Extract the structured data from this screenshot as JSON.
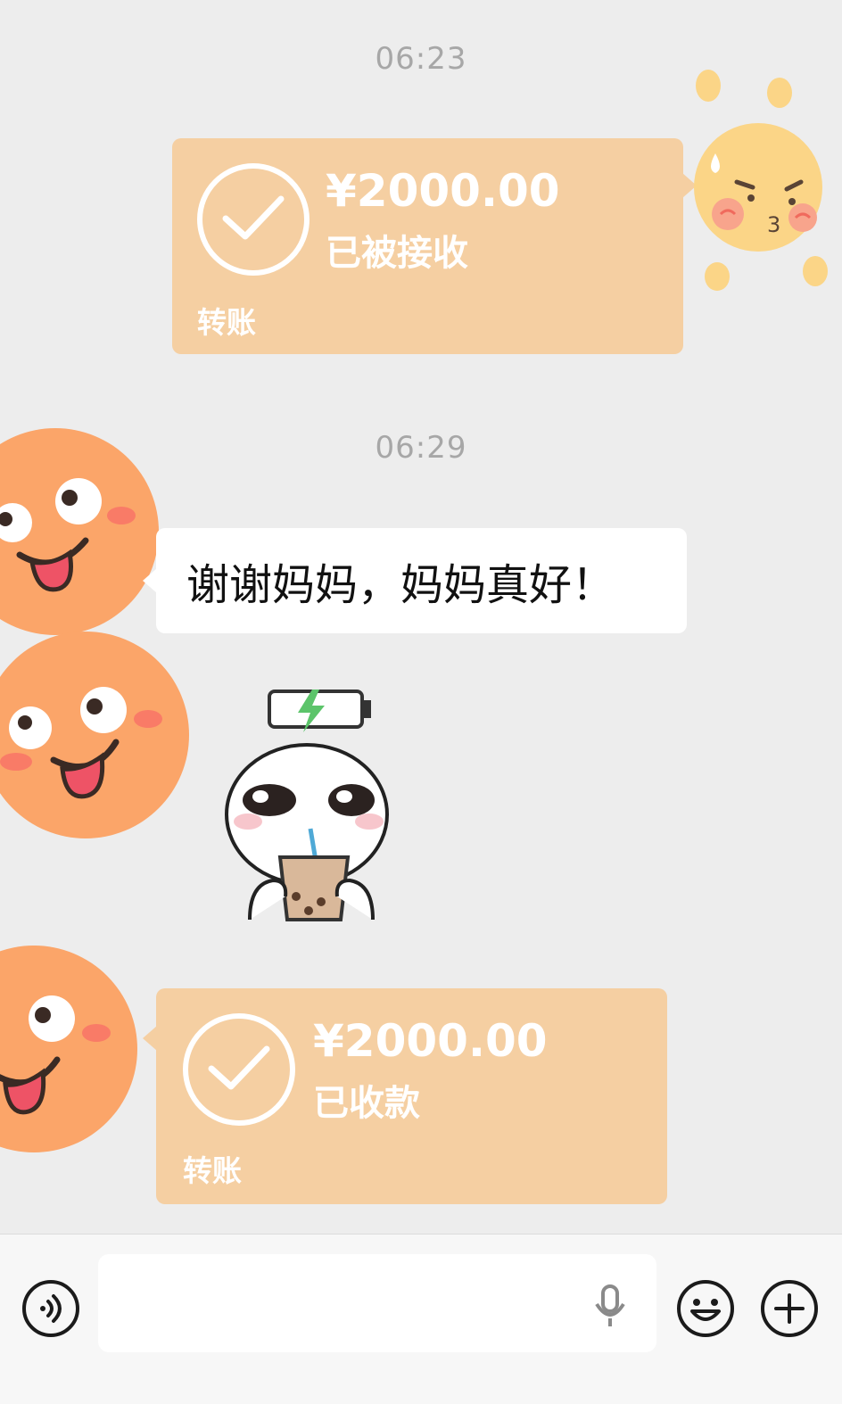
{
  "chat": {
    "timestamp_1": "06:23",
    "timestamp_2": "06:29",
    "transfer_sent": {
      "amount": "¥2000.00",
      "status": "已被接收",
      "kind": "转账"
    },
    "text_message": "谢谢妈妈，妈妈真好！",
    "transfer_received": {
      "amount": "¥2000.00",
      "status": "已收款",
      "kind": "转账"
    }
  },
  "input_bar": {
    "placeholder": "",
    "icons": [
      "voice-icon",
      "microphone-icon",
      "emoji-icon",
      "plus-icon"
    ]
  },
  "colors": {
    "background": "#ededed",
    "transfer_bubble": "#f5cfa2",
    "avatar_orange": "#fba569"
  }
}
